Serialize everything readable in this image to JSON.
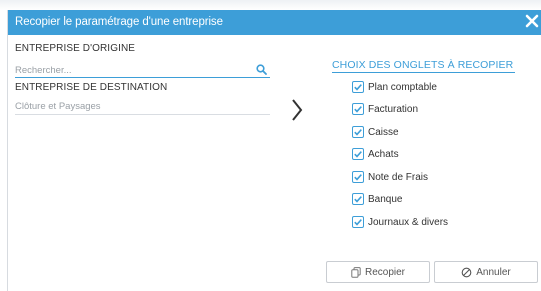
{
  "dialog": {
    "title": "Recopier le paramétrage d'une entreprise"
  },
  "origin": {
    "label": "ENTREPRISE D'ORIGINE",
    "search_placeholder": "Rechercher..."
  },
  "destination": {
    "label": "ENTREPRISE DE DESTINATION",
    "value": "Clôture et Paysages"
  },
  "tabs_section": {
    "title": "CHOIX DES ONGLETS À RECOPIER",
    "items": [
      {
        "label": "Plan comptable",
        "checked": true
      },
      {
        "label": "Facturation",
        "checked": true
      },
      {
        "label": "Caisse",
        "checked": true
      },
      {
        "label": "Achats",
        "checked": true
      },
      {
        "label": "Note de Frais",
        "checked": true
      },
      {
        "label": "Banque",
        "checked": true
      },
      {
        "label": "Journaux & divers",
        "checked": true
      }
    ]
  },
  "buttons": {
    "copy": "Recopier",
    "cancel": "Annuler"
  },
  "colors": {
    "accent": "#3d9ed8"
  }
}
